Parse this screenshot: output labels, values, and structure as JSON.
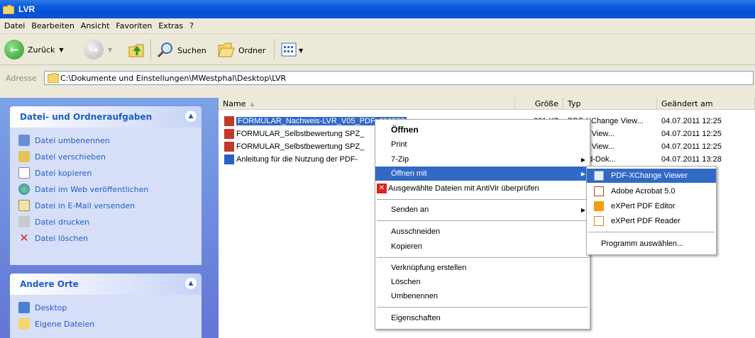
{
  "window": {
    "title": "LVR"
  },
  "menubar": [
    "Datei",
    "Bearbeiten",
    "Ansicht",
    "Favoriten",
    "Extras",
    "?"
  ],
  "toolbar": {
    "back": "Zurück",
    "search": "Suchen",
    "folders": "Ordner"
  },
  "address": {
    "label": "Adresse",
    "path": "C:\\Dokumente und Einstellungen\\MWestphal\\Desktop\\LVR"
  },
  "tasks": {
    "title": "Datei- und Ordneraufgaben",
    "items": [
      "Datei umbenennen",
      "Datei verschieben",
      "Datei kopieren",
      "Datei im Web veröffentlichen",
      "Datei in E-Mail versenden",
      "Datei drucken",
      "Datei löschen"
    ]
  },
  "other_places": {
    "title": "Andere Orte",
    "items": [
      "Desktop",
      "Eigene Dateien"
    ]
  },
  "columns": {
    "name": "Name",
    "size": "Größe",
    "type": "Typ",
    "modified": "Geändert am"
  },
  "files": [
    {
      "name": "FORMULAR_Nachweis-LVR_V05_PDF_110508",
      "size": "231 KB",
      "type": "PDF-XChange View...",
      "modified": "04.07.2011 12:25"
    },
    {
      "name": "FORMULAR_Selbstbewertung SPZ_",
      "size": "",
      "type": "hange View...",
      "modified": "04.07.2011 12:25"
    },
    {
      "name": "FORMULAR_Selbstbewertung SPZ_",
      "size": "",
      "type": "hange View...",
      "modified": "04.07.2011 12:25"
    },
    {
      "name": "Anleitung für die Nutzung der PDF-",
      "size": "",
      "type": "ft Word-Dok...",
      "modified": "04.07.2011 13:28"
    }
  ],
  "context_menu": {
    "open": "Öffnen",
    "print": "Print",
    "zip": "7-Zip",
    "open_with": "Öffnen mit",
    "antivir": "Ausgewählte Dateien mit AntiVir überprüfen",
    "send_to": "Senden an",
    "cut": "Ausschneiden",
    "copy": "Kopieren",
    "shortcut": "Verknüpfung erstellen",
    "delete": "Löschen",
    "rename": "Umbenennen",
    "properties": "Eigenschaften"
  },
  "submenu": {
    "items": [
      "PDF-XChange Viewer",
      "Adobe Acrobat 5.0",
      "eXPert PDF Editor",
      "eXPert PDF Reader"
    ],
    "choose": "Programm auswählen..."
  },
  "colors": {
    "titlebar": "#0a5ae0",
    "highlight": "#316ac5",
    "task_link": "#215dc6"
  }
}
